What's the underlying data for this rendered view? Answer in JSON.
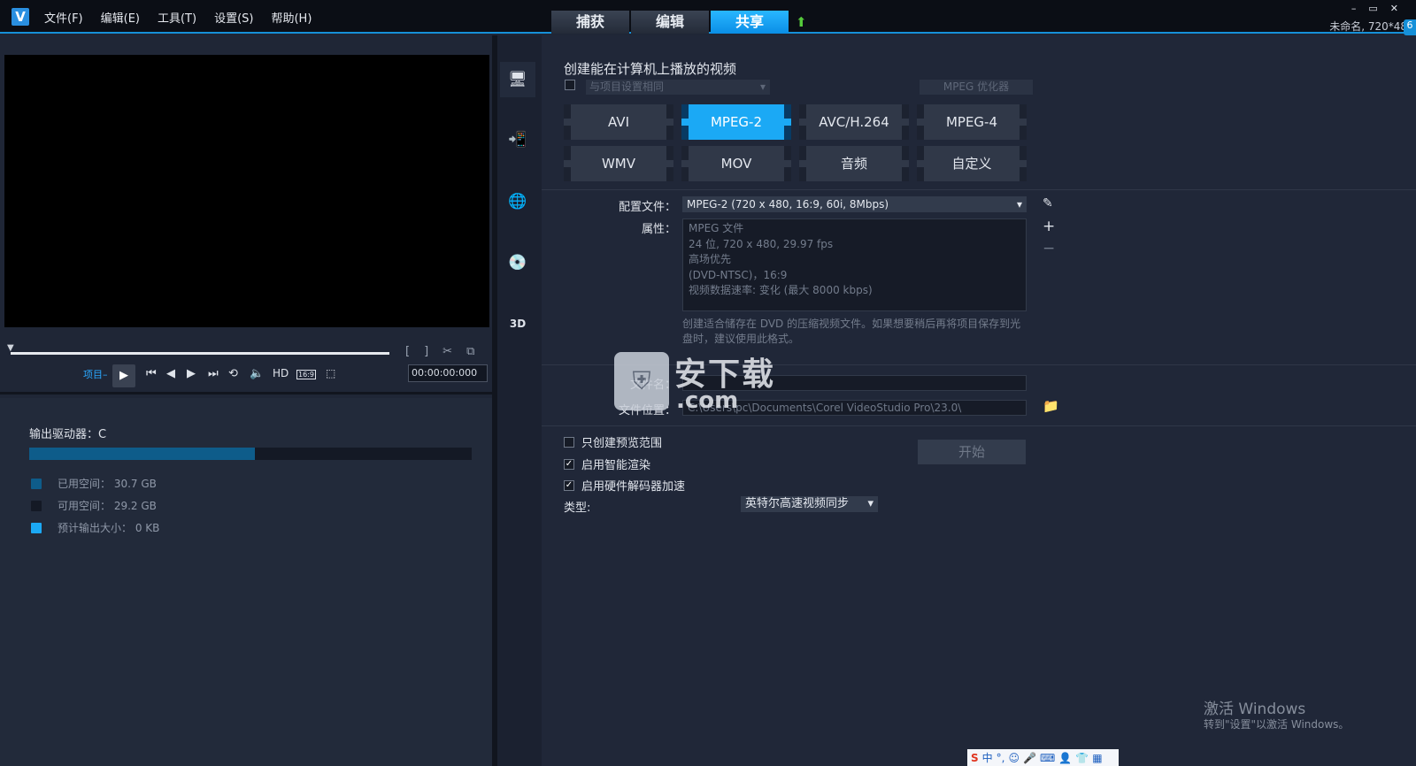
{
  "app": {
    "logo": "V",
    "project_info": "未命名, 720*48",
    "corner_label": "6"
  },
  "menu": [
    "文件(F)",
    "编辑(E)",
    "工具(T)",
    "设置(S)",
    "帮助(H)"
  ],
  "tabs": [
    {
      "label": "捕获"
    },
    {
      "label": "编辑"
    },
    {
      "label": "共享",
      "active": true
    }
  ],
  "window_controls": [
    "–",
    "▭",
    "✕"
  ],
  "player": {
    "project_label": "项目–",
    "hd_label": "HD",
    "aspect_label": "16:9",
    "timecode": "00:00:00:000"
  },
  "drive": {
    "label": "输出驱动器：C",
    "used_fraction": 0.51,
    "legend": [
      {
        "label": "已用空间：",
        "value": "30.7 GB",
        "color": "#0e5c8a"
      },
      {
        "label": "可用空间：",
        "value": "29.2 GB",
        "color": "#141925"
      },
      {
        "label": "预计输出大小：",
        "value": "0 KB",
        "color": "#1ba9f5"
      }
    ]
  },
  "sidebar_icons": [
    "monitor-icon",
    "device-icon",
    "globe-icon",
    "disc-icon",
    "3d-icon"
  ],
  "share": {
    "title": "创建能在计算机上播放的视频",
    "same_as_project": "与项目设置相同",
    "mpeg_optimizer": "MPEG 优化器",
    "formats": [
      "AVI",
      "MPEG-2",
      "AVC/H.264",
      "MPEG-4",
      "WMV",
      "MOV",
      "音频",
      "自定义"
    ],
    "active_format": "MPEG-2",
    "profile_label": "配置文件：",
    "profile_value": "MPEG-2 (720 x 480, 16:9, 60i, 8Mbps)",
    "attributes_label": "属性：",
    "attributes": [
      "MPEG 文件",
      "24 位, 720 x 480, 29.97 fps",
      "高场优先",
      "(DVD-NTSC)，16:9",
      "视频数据速率: 变化 (最大  8000 kbps)"
    ],
    "description": "创建适合储存在 DVD 的压缩视频文件。如果想要稍后再将项目保存到光盘时，建议使用此格式。",
    "filename_label": "文件名：",
    "filename_value": "",
    "location_label": "文件位置：",
    "location_value": "C:\\Users\\pc\\Documents\\Corel VideoStudio Pro\\23.0\\",
    "options": [
      {
        "label": "只创建预览范围",
        "checked": false
      },
      {
        "label": "启用智能渲染",
        "checked": true
      },
      {
        "label": "启用硬件解码器加速",
        "checked": true
      }
    ],
    "type_label": "类型:",
    "type_value": "英特尔高速视频同步",
    "start_button": "开始"
  },
  "watermark": {
    "line1": "激活 Windows",
    "line2": "转到\"设置\"以激活 Windows。"
  },
  "site_watermark": {
    "text": "安下载",
    "domain": ".com"
  },
  "ime": {
    "brand": "S",
    "mode": "中"
  }
}
